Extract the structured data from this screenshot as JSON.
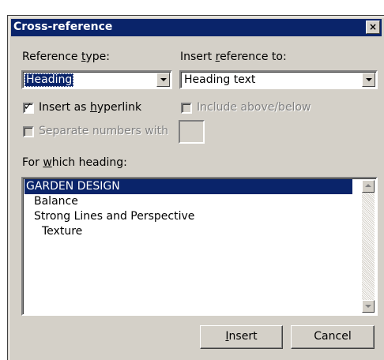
{
  "dialog": {
    "title": "Cross-reference",
    "close_glyph": "×"
  },
  "reference_type": {
    "label_pre": "Reference ",
    "label_key": "t",
    "label_post": "ype:",
    "value": "Heading"
  },
  "insert_reference_to": {
    "label_pre": "Insert ",
    "label_key": "r",
    "label_post": "eference to:",
    "value": "Heading text"
  },
  "checkboxes": {
    "hyperlink": {
      "pre": "Insert as ",
      "key": "h",
      "post": "yperlink",
      "checked": true,
      "check_glyph": "✓"
    },
    "above_below": {
      "label": "Include above/below",
      "checked": false,
      "enabled": false
    },
    "separate_numbers": {
      "label": "Separate numbers with",
      "checked": false,
      "enabled": false
    }
  },
  "heading_list": {
    "label_pre": "For ",
    "label_key": "w",
    "label_post": "hich heading:",
    "items": [
      {
        "text": "GARDEN DESIGN",
        "level": 1,
        "selected": true
      },
      {
        "text": "Balance",
        "level": 2,
        "selected": false
      },
      {
        "text": "Strong Lines and Perspective",
        "level": 2,
        "selected": false
      },
      {
        "text": "Texture",
        "level": 3,
        "selected": false
      }
    ]
  },
  "buttons": {
    "insert": {
      "key": "I",
      "rest": "nsert"
    },
    "cancel": "Cancel"
  },
  "colors": {
    "face": "#d4d0c8",
    "selection": "#0a246a",
    "titlebar": "#0a246a"
  }
}
